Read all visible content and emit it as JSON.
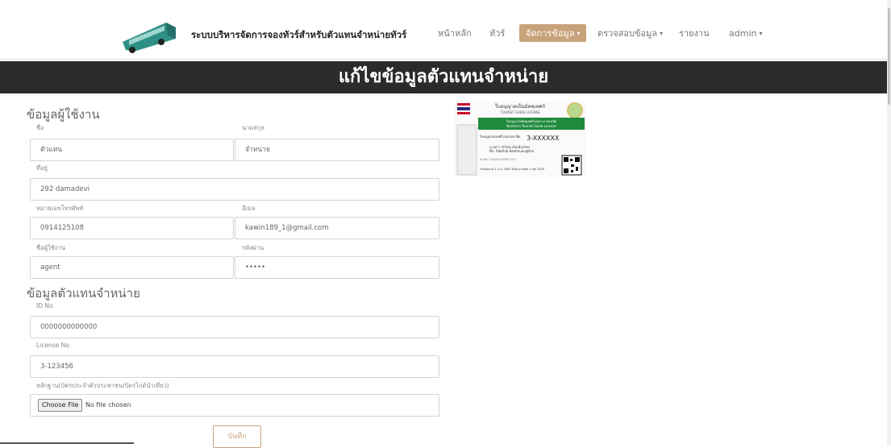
{
  "header": {
    "brand": "ระบบบริหารจัดการจองทัวร์สำหรับตัวแทนจำหน่ายทัวร์",
    "nav": [
      {
        "label": "หน้าหลัก"
      },
      {
        "label": "ทัวร์"
      },
      {
        "label": "จัดการข้อมูล",
        "caret": "▾"
      },
      {
        "label": "ตรวจสอบข้อมูล",
        "caret": "▾"
      },
      {
        "label": "รายงาน"
      },
      {
        "label": "admin",
        "caret": "▾"
      }
    ]
  },
  "banner": {
    "title": "แก้ไขข้อมูลตัวแทนจำหน่าย"
  },
  "user_section": {
    "title": "ข้อมูลผู้ใช้งาน",
    "first_name": {
      "label": "ชื่อ",
      "value": "ตัวแทน"
    },
    "last_name": {
      "label": "นามสกุล",
      "value": "จำหน่าย"
    },
    "address": {
      "label": "ที่อยู่",
      "value": "292 damadevi"
    },
    "phone": {
      "label": "หมายเลขโทรศัพท์",
      "value": "0914125108"
    },
    "email": {
      "label": "อีเมล",
      "value": "kawin189_1@gmail.com"
    },
    "username": {
      "label": "ชื่อผู้ใช้งาน",
      "value": "agent"
    },
    "password": {
      "label": "รหัสผ่าน",
      "value": "•••••"
    }
  },
  "agent_section": {
    "title": "ข้อมูลตัวแทนจำหน่าย",
    "id_no": {
      "label": "ID No.",
      "value": "0000000000000"
    },
    "license_no": {
      "label": "License No.",
      "value": "3-123456"
    },
    "evidence": {
      "label": "หลักฐาน(บัตรประจำตัวประชาชน/บัตรไกด์นำเที่ยว)",
      "button": "Choose File",
      "status": "No file chosen"
    }
  },
  "save_button": "บันทึก",
  "license_card": {
    "title": "ใบอนุญาตเป็นมัคคุเทศก์",
    "subtitle": "TOURIST GUIDE LICENSE",
    "type_th": "ใบอนุญาตมัคคุเทศก์เฉพาะภาคเหนือ",
    "type_en": "Northern Tourist Guide License",
    "license_label": "ใบอนุญาตเลขที่ License No.",
    "license_no": "3-XXXXXX",
    "name_th": "นางสาว รักไทย เกิดเมืองไทย",
    "name_en": "Ms. Rakthai Koetmuangthai",
    "id_line": "ID No. 3 0000 00000 00 0",
    "expiry": "วันหมดอายุ 1 ม.ค. 2562 Expiry Date 1 Jan 2019"
  },
  "colors": {
    "accent": "#c8a27a",
    "banner": "#2b2b2b",
    "bus": "#2e8f86"
  }
}
